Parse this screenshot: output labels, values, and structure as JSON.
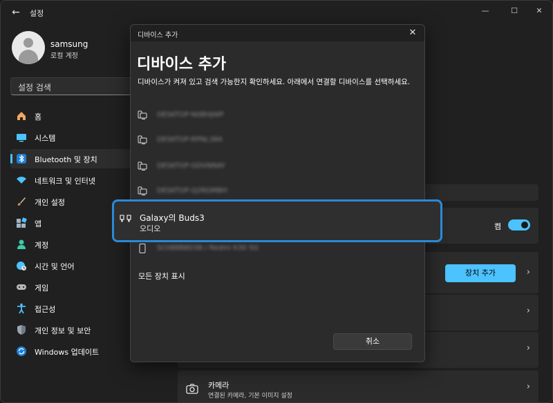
{
  "window": {
    "title": "설정",
    "back_icon": "back-arrow-icon",
    "controls": [
      "minimize-icon",
      "maximize-icon",
      "close-icon"
    ]
  },
  "profile": {
    "name": "samsung",
    "account_type": "로컬 계정"
  },
  "search": {
    "placeholder": "설정 검색"
  },
  "sidebar": {
    "items": [
      {
        "label": "홈",
        "icon": "home-icon",
        "active": false
      },
      {
        "label": "시스템",
        "icon": "system-icon",
        "active": false
      },
      {
        "label": "Bluetooth 및 장치",
        "icon": "bluetooth-icon",
        "active": true
      },
      {
        "label": "네트워크 및 인터넷",
        "icon": "network-icon",
        "active": false
      },
      {
        "label": "개인 설정",
        "icon": "brush-icon",
        "active": false
      },
      {
        "label": "앱",
        "icon": "apps-icon",
        "active": false
      },
      {
        "label": "계정",
        "icon": "account-icon",
        "active": false
      },
      {
        "label": "시간 및 언어",
        "icon": "globe-clock-icon",
        "active": false
      },
      {
        "label": "게임",
        "icon": "gamepad-icon",
        "active": false
      },
      {
        "label": "접근성",
        "icon": "accessibility-icon",
        "active": false
      },
      {
        "label": "개인 정보 및 보안",
        "icon": "shield-icon",
        "active": false
      },
      {
        "label": "Windows 업데이트",
        "icon": "update-icon",
        "active": false
      }
    ]
  },
  "content": {
    "bluetooth_toggle_label": "켬",
    "bluetooth_toggle_on": true,
    "add_device_label": "장치 추가",
    "camera_title": "카메라",
    "camera_sub": "연결된 카메라, 기본 이미지 설정"
  },
  "dialog": {
    "bar_title": "디바이스 추가",
    "heading": "디바이스 추가",
    "description": "디바이스가 켜져 있고 검색 가능한지 확인하세요. 아래에서 연결할 디바이스를 선택하세요.",
    "blurred_devices": [
      {
        "name": "DESKTOP-N0BHJWP",
        "icon": "computer-phone-icon"
      },
      {
        "name": "DESKTOP-RPNL384",
        "icon": "computer-phone-icon"
      },
      {
        "name": "DESKTOP-GDVNNAY",
        "icon": "computer-phone-icon"
      },
      {
        "name": "DESKTOP-Q2RDMBH",
        "icon": "computer-phone-icon"
      },
      {
        "name": "SC088B8D38 / Redmi K30 5G",
        "icon": "phone-icon"
      }
    ],
    "selected_device": {
      "name": "Galaxy의 Buds3",
      "type": "오디오",
      "icon": "earbuds-icon"
    },
    "show_all": "모든 장치 표시",
    "cancel": "취소"
  },
  "colors": {
    "accent": "#4cc2ff",
    "highlight_border": "#2a8ad8",
    "background": "#202020"
  }
}
